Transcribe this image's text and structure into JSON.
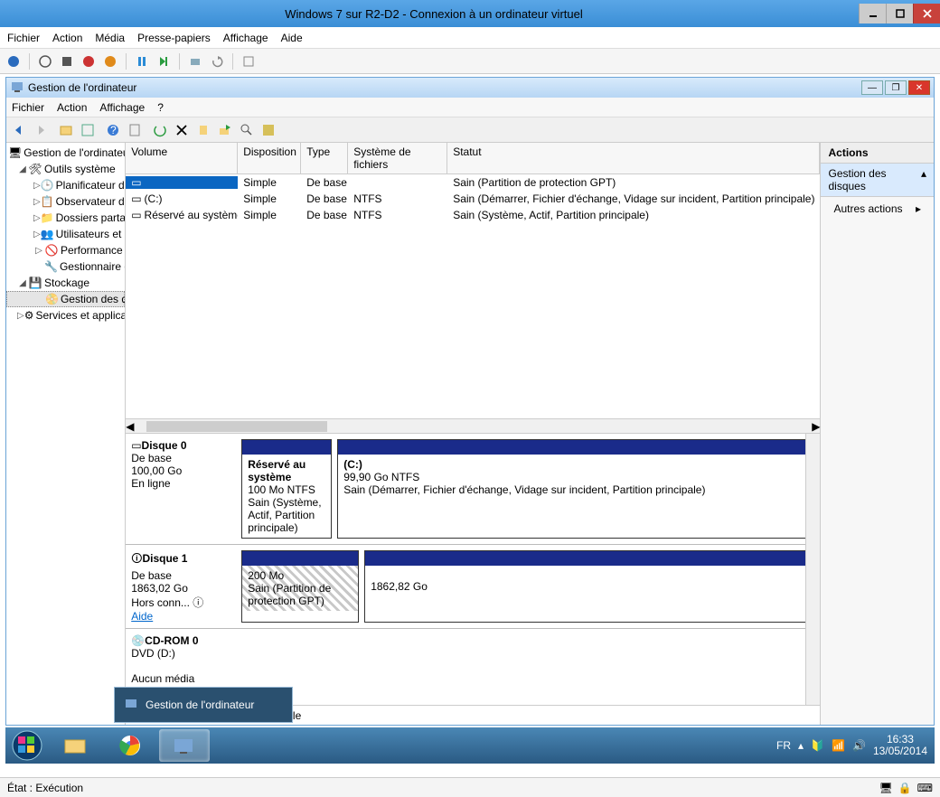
{
  "vm": {
    "title": "Windows 7 sur R2-D2 - Connexion à un ordinateur virtuel",
    "menu": {
      "fichier": "Fichier",
      "action": "Action",
      "media": "Média",
      "presse": "Presse-papiers",
      "affichage": "Affichage",
      "aide": "Aide"
    }
  },
  "inner": {
    "title": "Gestion de l'ordinateur",
    "menu": {
      "fichier": "Fichier",
      "action": "Action",
      "affichage": "Affichage",
      "help": "?"
    }
  },
  "tree": {
    "root": "Gestion de l'ordinateur (local)",
    "outils": "Outils système",
    "planif": "Planificateur de tâches",
    "obs": "Observateur d'événements",
    "dossiers": "Dossiers partagés",
    "users": "Utilisateurs et groupes locaux",
    "perf": "Performance",
    "devmgr": "Gestionnaire de périphériques",
    "stockage": "Stockage",
    "disques": "Gestion des disques",
    "services": "Services et applications"
  },
  "columns": {
    "volume": "Volume",
    "dispo": "Disposition",
    "type": "Type",
    "fs": "Système de fichiers",
    "statut": "Statut"
  },
  "volumes": [
    {
      "name": "",
      "dispo": "Simple",
      "type": "De base",
      "fs": "",
      "statut": "Sain (Partition de protection GPT)"
    },
    {
      "name": "(C:)",
      "dispo": "Simple",
      "type": "De base",
      "fs": "NTFS",
      "statut": "Sain (Démarrer, Fichier d'échange, Vidage sur incident, Partition principale)"
    },
    {
      "name": "Réservé au système",
      "dispo": "Simple",
      "type": "De base",
      "fs": "NTFS",
      "statut": "Sain (Système, Actif, Partition principale)"
    }
  ],
  "disks": {
    "d0": {
      "name": "Disque 0",
      "type": "De base",
      "size": "100,00 Go",
      "status": "En ligne",
      "p1": {
        "title": "Réservé au système",
        "l2": "100 Mo NTFS",
        "l3": "Sain (Système, Actif, Partition principale)"
      },
      "p2": {
        "title": "(C:)",
        "l2": "99,90 Go NTFS",
        "l3": "Sain (Démarrer, Fichier d'échange, Vidage sur incident, Partition principale)"
      }
    },
    "d1": {
      "name": "Disque 1",
      "type": "De base",
      "size": "1863,02 Go",
      "status": "Hors conn...",
      "help": "Aide",
      "p1": {
        "l2": "200 Mo",
        "l3": "Sain (Partition de protection GPT)"
      },
      "p2": {
        "l2": "1862,82 Go"
      }
    },
    "cd": {
      "name": "CD-ROM 0",
      "type": "DVD (D:)",
      "status": "Aucun média"
    }
  },
  "legend": {
    "primary": "tion principale"
  },
  "actions": {
    "header": "Actions",
    "section": "Gestion des disques",
    "more": "Autres actions"
  },
  "preview": {
    "title": "Gestion de l'ordinateur"
  },
  "tray": {
    "lang": "FR",
    "time": "16:33",
    "date": "13/05/2014"
  },
  "host_status": {
    "text": "État : Exécution"
  }
}
